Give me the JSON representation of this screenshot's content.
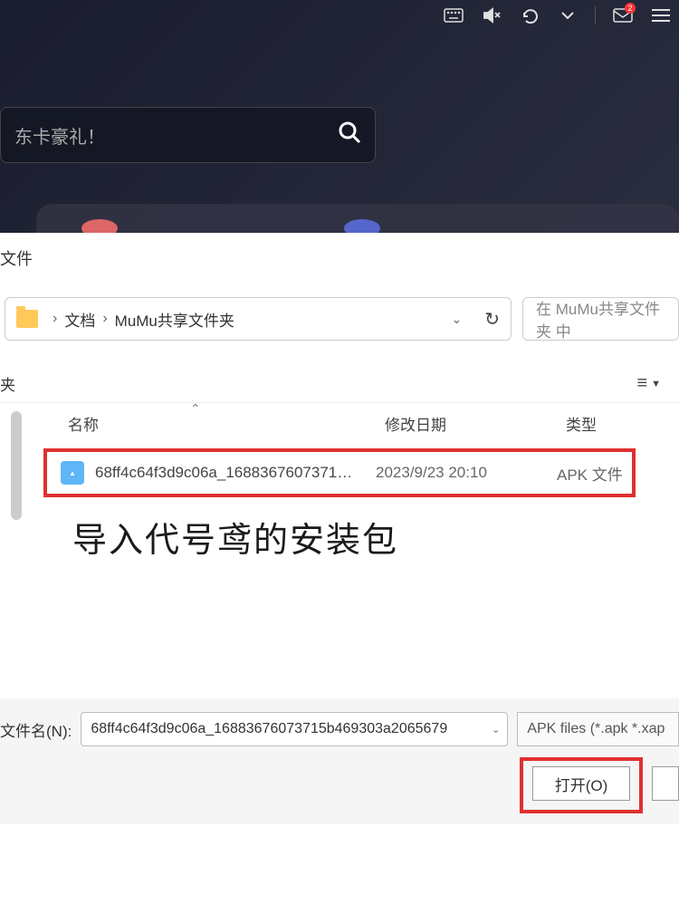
{
  "toolbar": {
    "notification_count": "2"
  },
  "search": {
    "placeholder": "东卡豪礼！"
  },
  "dialog": {
    "title": "文件",
    "breadcrumb": {
      "items": [
        "文档",
        "MuMu共享文件夹"
      ]
    },
    "search_placeholder": "在 MuMu共享文件夹 中",
    "view_label": "夹",
    "columns": {
      "name": "名称",
      "date": "修改日期",
      "type": "类型"
    },
    "files": [
      {
        "name": "68ff4c64f3d9c06a_1688367607371…",
        "date": "2023/9/23 20:10",
        "type": "APK 文件"
      }
    ],
    "instruction": "导入代号鸢的安装包",
    "filename_label": "文件名(N):",
    "filename_value": "68ff4c64f3d9c06a_16883676073715b469303a2065679",
    "filter": "APK files (*.apk *.xap",
    "open_button": "打开(O)"
  }
}
